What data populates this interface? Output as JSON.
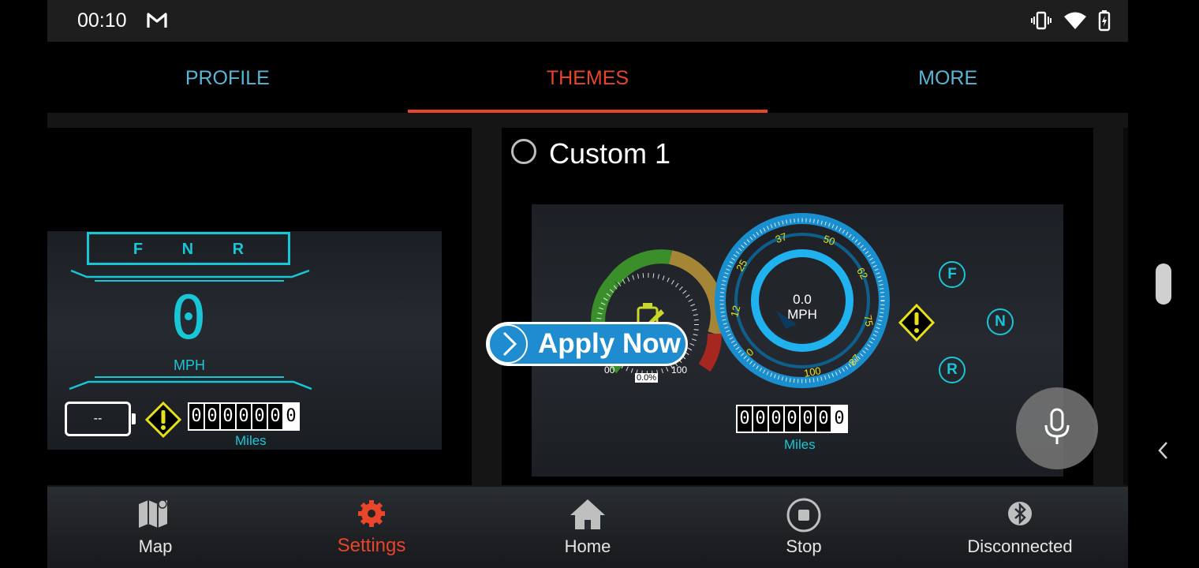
{
  "status_bar": {
    "time": "00:10",
    "icons": [
      "gmail-icon",
      "vibrate-icon",
      "wifi-icon",
      "battery-charging-icon"
    ]
  },
  "tabs": [
    {
      "label": "PROFILE",
      "active": false
    },
    {
      "label": "THEMES",
      "active": true
    },
    {
      "label": "MORE",
      "active": false
    }
  ],
  "theme_left": {
    "gears": "F N R",
    "speed": "0",
    "speed_unit": "MPH",
    "battery_text": "--",
    "odometer": [
      "0",
      "0",
      "0",
      "0",
      "0",
      "0",
      "0"
    ],
    "miles_label": "Miles"
  },
  "theme_custom": {
    "title": "Custom 1",
    "selected": false,
    "battery_gauge": {
      "min_label": "00",
      "max_label": "100",
      "percent_label": "0.0%"
    },
    "speedometer": {
      "speed": "0.0",
      "unit": "MPH",
      "scale_labels": [
        "0",
        "12",
        "25",
        "37",
        "50",
        "62",
        "75",
        "87",
        "100"
      ]
    },
    "gears": [
      "F",
      "N",
      "R"
    ],
    "odometer": [
      "0",
      "0",
      "0",
      "0",
      "0",
      "0",
      "0"
    ],
    "miles_label": "Miles"
  },
  "apply_button": {
    "label": "Apply Now"
  },
  "bottom_nav": [
    {
      "label": "Map",
      "icon": "map-icon",
      "active": false
    },
    {
      "label": "Settings",
      "icon": "gear-icon",
      "active": true
    },
    {
      "label": "Home",
      "icon": "home-icon",
      "active": false
    },
    {
      "label": "Stop",
      "icon": "stop-icon",
      "active": false
    },
    {
      "label": "Disconnected",
      "icon": "bluetooth-icon",
      "active": false
    }
  ],
  "colors": {
    "accent_active": "#e8452a",
    "tab_inactive": "#5ab4d6",
    "cyan": "#19c6d6",
    "gauge_yellow": "#e6e01a",
    "apply_blue": "#1f8ccf"
  }
}
